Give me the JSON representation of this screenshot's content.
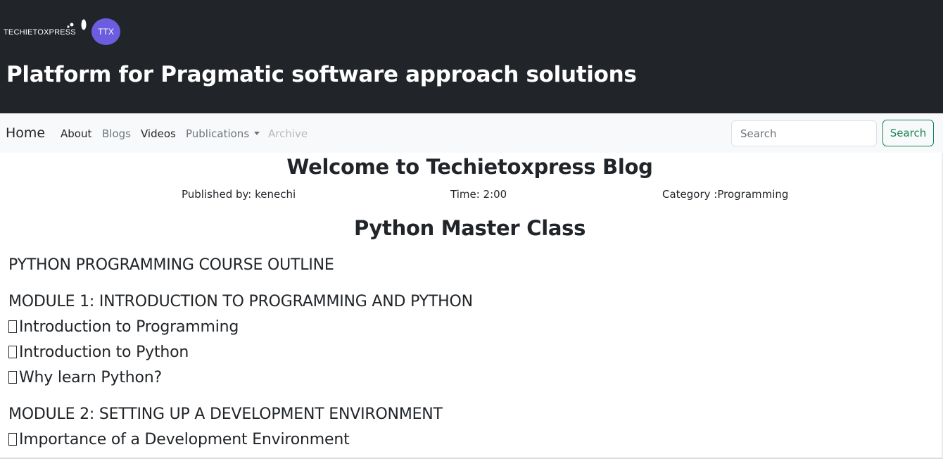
{
  "header": {
    "logo_text": "TECHIETOXPRESS",
    "avatar_text": "TTX",
    "site_title": "Platform for Pragmatic software approach solutions"
  },
  "nav": {
    "brand": "Home",
    "links": [
      {
        "label": "About"
      },
      {
        "label": "Blogs"
      },
      {
        "label": "Videos"
      },
      {
        "label": "Publications"
      },
      {
        "label": "Archive"
      }
    ],
    "search_placeholder": "Search",
    "search_button": "Search"
  },
  "post": {
    "heading": "Welcome to Techietoxpress Blog",
    "author": "Published by: kenechi",
    "time": "Time: 2:00",
    "category": "Category :Programming",
    "title": "Python Master Class",
    "lines": [
      "PYTHON PROGRAMMING COURSE OUTLINE",
      "MODULE 1: INTRODUCTION TO PROGRAMMING AND PYTHON",
      "Introduction to Programming",
      "Introduction to Python",
      "Why learn Python?",
      "MODULE 2: SETTING UP A DEVELOPMENT ENVIRONMENT",
      "Importance of a Development Environment"
    ]
  },
  "colors": {
    "header_bg": "#212529",
    "navbar_bg": "#f8f9fa",
    "avatar_bg": "#6b5ce0",
    "search_button": "#198754"
  },
  "icons": {
    "logo": "logo-dots-icon",
    "bullet": "missing-glyph-box-icon",
    "dropdown": "caret-down-icon"
  }
}
